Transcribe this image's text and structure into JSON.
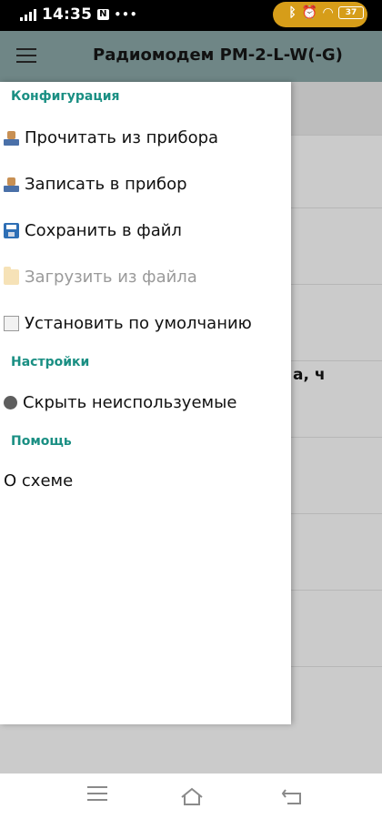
{
  "status_bar": {
    "time": "14:35",
    "badge": "N",
    "dots": "•••",
    "battery": "37",
    "icons": [
      "signal-icon",
      "bluetooth-icon",
      "alarm-icon",
      "wifi-icon",
      "battery-icon"
    ]
  },
  "app_bar": {
    "title": "Радиомодем РМ-2-L-W(-G)",
    "menu_icon": "hamburger-icon"
  },
  "background": {
    "partial_label": "а, ч"
  },
  "drawer": {
    "sections": [
      {
        "header": "Конфигурация",
        "items": [
          {
            "label": "Прочитать из прибора",
            "icon": "read-device-icon",
            "enabled": true
          },
          {
            "label": "Записать в прибор",
            "icon": "write-device-icon",
            "enabled": true
          },
          {
            "label": "Сохранить в файл",
            "icon": "floppy-disk-icon",
            "enabled": true
          },
          {
            "label": "Загрузить из файла",
            "icon": "folder-icon",
            "enabled": false
          },
          {
            "label": "Установить по умолчанию",
            "icon": "checkbox-icon",
            "enabled": true
          }
        ]
      },
      {
        "header": "Настройки",
        "items": [
          {
            "label": "Скрыть неиспользуемые",
            "icon": "radio-icon",
            "enabled": true
          }
        ]
      },
      {
        "header": "Помощь",
        "items": [
          {
            "label": "О схеме",
            "icon": "",
            "enabled": true
          }
        ]
      }
    ]
  },
  "colors": {
    "accent": "#1a8f83",
    "app_bar": "#6f8686",
    "status_pill": "#e2a51a"
  },
  "bottom_nav": {
    "icons": [
      "menu-icon",
      "home-icon",
      "back-icon"
    ]
  }
}
